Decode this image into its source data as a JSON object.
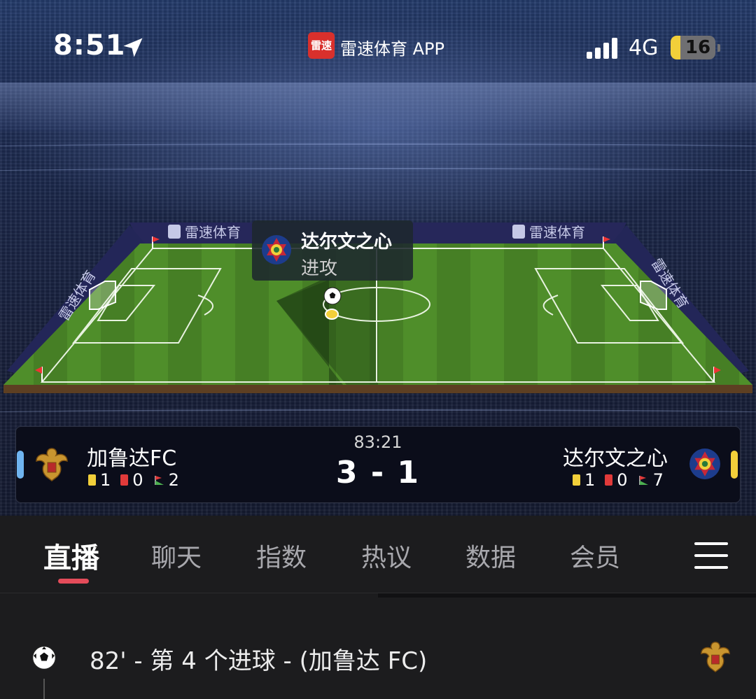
{
  "status_bar": {
    "time": "8:51",
    "app_badge": "雷速",
    "app_name": "雷速体育 APP",
    "network": "4G",
    "battery": "16"
  },
  "pitch": {
    "board_text": "雷速体育",
    "event_team": "达尔文之心",
    "event_action": "进攻"
  },
  "match": {
    "clock": "83:21",
    "score": "3 - 1",
    "home": {
      "name": "加鲁达FC",
      "yellow": "1",
      "red": "0",
      "corners": "2",
      "side_color": "#6fb4f0"
    },
    "away": {
      "name": "达尔文之心",
      "yellow": "1",
      "red": "0",
      "corners": "7",
      "side_color": "#f2cf3a"
    }
  },
  "tabs": [
    {
      "label": "直播",
      "active": true
    },
    {
      "label": "聊天"
    },
    {
      "label": "指数"
    },
    {
      "label": "热议"
    },
    {
      "label": "数据"
    },
    {
      "label": "会员"
    }
  ],
  "feed": [
    {
      "icon": "soccer-ball-icon",
      "text": "82' - 第 4 个进球 - (加鲁达 FC)",
      "team_icon": "garuda-crest-icon"
    }
  ],
  "colors": {
    "accent": "#e44c5a",
    "yellow_card": "#f2cf3a",
    "red_card": "#e13a3a"
  }
}
